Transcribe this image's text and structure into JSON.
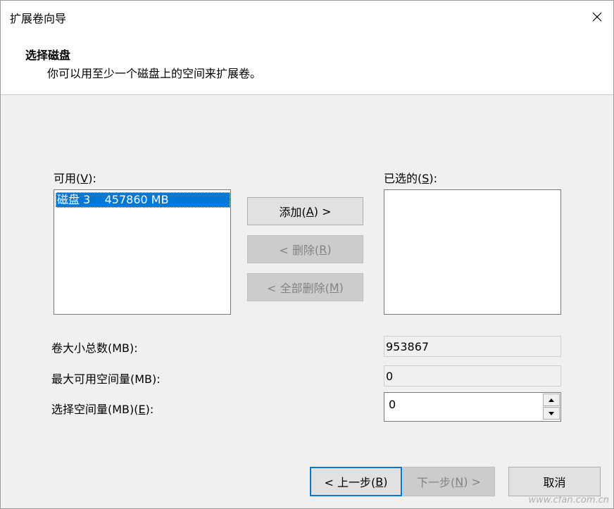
{
  "window": {
    "title": "扩展卷向导",
    "close_label": "✕"
  },
  "header": {
    "title": "选择磁盘",
    "subtitle": "你可以用至少一个磁盘上的空间来扩展卷。"
  },
  "available": {
    "label_main": "可用(",
    "label_key": "V",
    "label_end": "):",
    "items": [
      {
        "text": "磁盘 3    457860 MB"
      }
    ]
  },
  "selected": {
    "label_main": "已选的(",
    "label_key": "S",
    "label_end": "):"
  },
  "buttons": {
    "add_main": "添加(",
    "add_key": "A",
    "add_end": ") >",
    "remove_main": "< 删除(",
    "remove_key": "R",
    "remove_end": ")",
    "remove_all_main": "< 全部删除(",
    "remove_all_key": "M",
    "remove_all_end": ")"
  },
  "fields": {
    "total_label": "卷大小总数(MB):",
    "total_value": "953867",
    "max_label": "最大可用空间量(MB):",
    "max_value": "0",
    "select_label_main": "选择空间量(MB)(",
    "select_label_key": "E",
    "select_label_end": "):",
    "select_value": "0"
  },
  "footer": {
    "back_main": "< 上一步(",
    "back_key": "B",
    "back_end": ")",
    "next_main": "下一步(",
    "next_key": "N",
    "next_end": ") >",
    "cancel": "取消"
  },
  "watermark": "www.cfan.com.cn"
}
